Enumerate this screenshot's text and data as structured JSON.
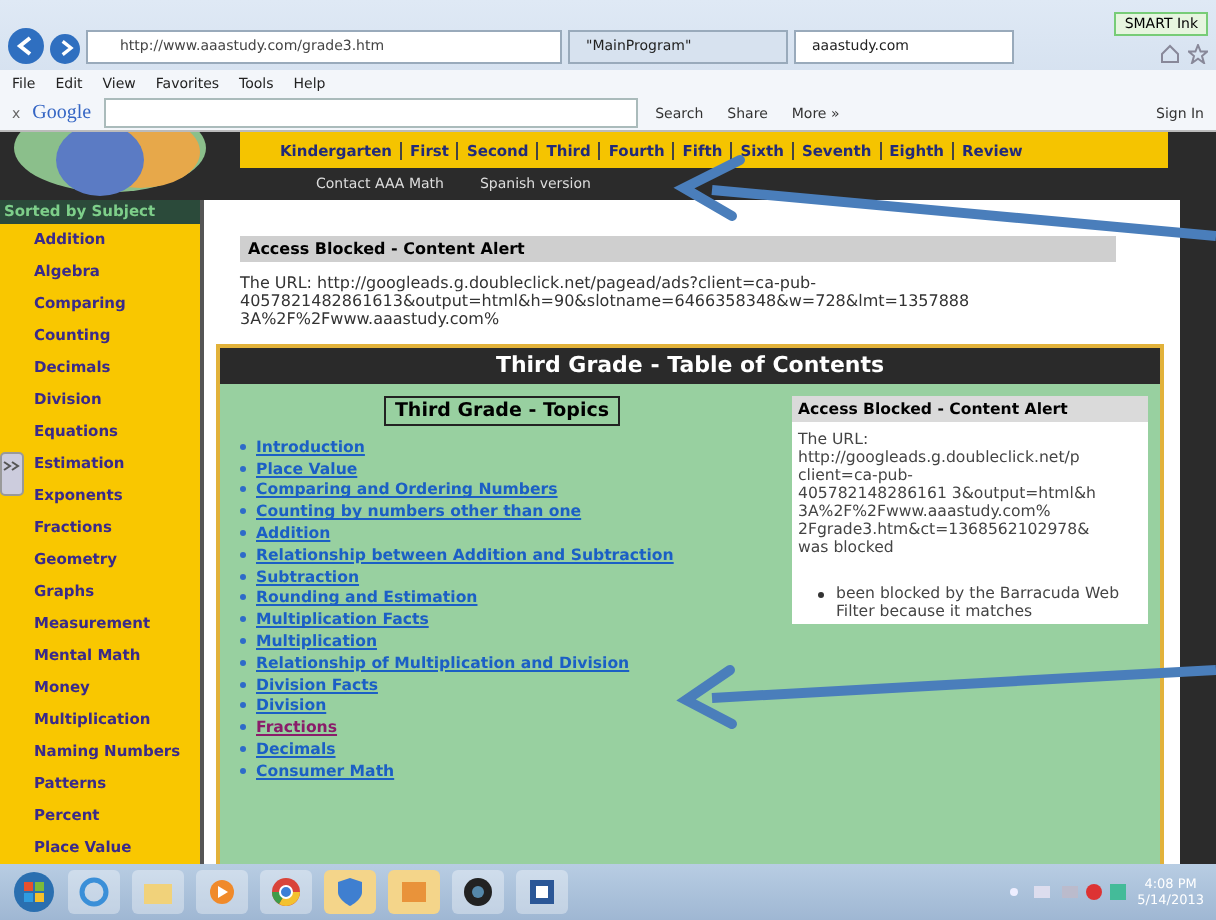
{
  "browser": {
    "address": "http://www.aaastudy.com/grade3.htm",
    "smart_ink": "SMART Ink",
    "tabs": [
      {
        "label": "\"MainProgram\"",
        "selected": false
      },
      {
        "label": "aaastudy.com",
        "selected": true
      }
    ]
  },
  "menu": [
    "File",
    "Edit",
    "View",
    "Favorites",
    "Tools",
    "Help"
  ],
  "google_toolbar": {
    "close": "x",
    "logo": "Google",
    "search": "Search",
    "share": "Share",
    "more": "More »",
    "sign_in": "Sign In"
  },
  "grade_nav": [
    "Kindergarten",
    "First",
    "Second",
    "Third",
    "Fourth",
    "Fifth",
    "Sixth",
    "Seventh",
    "Eighth",
    "Review"
  ],
  "sub_nav": [
    "Contact AAA Math",
    "Spanish version"
  ],
  "sidebar": {
    "title": "Sorted by Subject",
    "items": [
      "Addition",
      "Algebra",
      "Comparing",
      "Counting",
      "Decimals",
      "Division",
      "Equations",
      "Estimation",
      "Exponents",
      "Fractions",
      "Geometry",
      "Graphs",
      "Measurement",
      "Mental Math",
      "Money",
      "Multiplication",
      "Naming Numbers",
      "Patterns",
      "Percent",
      "Place Value"
    ]
  },
  "alert": {
    "title": "Access Blocked - Content Alert",
    "lines": [
      "The URL: http://googleads.g.doubleclick.net/pagead/ads?client=ca-pub-",
      "4057821482861613&output=html&h=90&slotname=6466358348&w=728&lmt=1357888",
      "3A%2F%2Fwww.aaastudy.com%"
    ]
  },
  "toc": {
    "title": "Third Grade - Table of Contents",
    "topics_title": "Third Grade - Topics",
    "topics": [
      {
        "label": "Introduction",
        "visited": false
      },
      {
        "label": "Place Value",
        "visited": false
      },
      {
        "label": "Comparing and Ordering Numbers",
        "visited": false
      },
      {
        "label": "Counting by numbers other than one",
        "visited": false
      },
      {
        "label": "Addition",
        "visited": false
      },
      {
        "label": "Relationship between Addition and Subtraction",
        "visited": false
      },
      {
        "label": "Subtraction",
        "visited": false
      },
      {
        "label": "Rounding and Estimation",
        "visited": false
      },
      {
        "label": "Multiplication Facts",
        "visited": false
      },
      {
        "label": "Multiplication",
        "visited": false
      },
      {
        "label": "Relationship of Multiplication and Division",
        "visited": false
      },
      {
        "label": "Division Facts",
        "visited": false
      },
      {
        "label": "Division",
        "visited": false
      },
      {
        "label": "Fractions",
        "visited": true
      },
      {
        "label": "Decimals",
        "visited": false
      },
      {
        "label": "Consumer Math",
        "visited": false
      }
    ],
    "side_alert": {
      "title": "Access Blocked - Content Alert",
      "lines": [
        "The URL:",
        "http://googleads.g.doubleclick.net/p",
        "client=ca-pub-",
        "405782148286161 3&output=html&h",
        "3A%2F%2Fwww.aaastudy.com%",
        "2Fgrade3.htm&ct=1368562102978&",
        "was blocked"
      ],
      "bullet": "been blocked by the Barracuda Web Filter because it matches"
    }
  },
  "taskbar": {
    "time": "4:08 PM",
    "date": "5/14/2013"
  }
}
